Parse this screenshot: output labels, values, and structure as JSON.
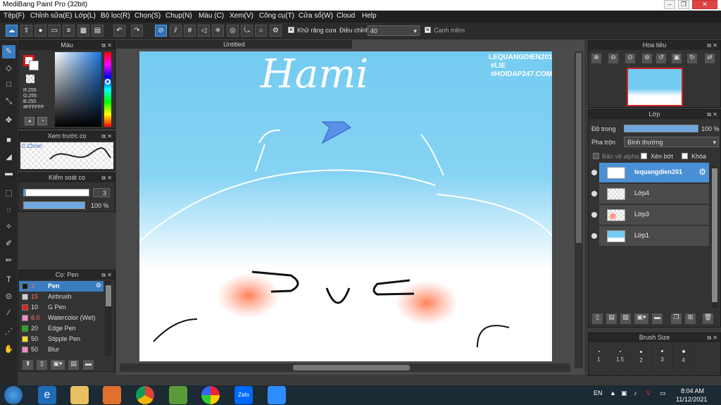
{
  "app": {
    "title": "MediBang Paint Pro (32bit)"
  },
  "menu": [
    "Tệp(F)",
    "Chỉnh sửa(E)",
    "Lớp(L)",
    "Bộ lọc(R)",
    "Chọn(S)",
    "Chụp(N)",
    "Màu (C)",
    "Xem(V)",
    "Công cụ(T)",
    "Cửa sổ(W)",
    "Cloud",
    "Help"
  ],
  "toolbar": {
    "antialias_label": "Khử răng cưa",
    "adjust_label": "Điều chỉnh",
    "adjust_value": "40",
    "sharp_edge_label": "Cạnh mềm",
    "antialias_mark": "✕",
    "sharp_mark": "✕"
  },
  "color_panel": {
    "title": "Màu",
    "r": "R:255",
    "g": "G:255",
    "b": "B:255",
    "hex": "#FFFFFF"
  },
  "brush_preview": {
    "title": "Xem trước cọ",
    "size": "0.22mm"
  },
  "brush_control": {
    "title": "Kiểm soát cọ",
    "size_value": "3",
    "opacity_value": "100 %"
  },
  "brush_list": {
    "title": "Cọ: Pen",
    "items": [
      {
        "size": "3",
        "name": "Pen",
        "color": "#1a1a1a"
      },
      {
        "size": "15",
        "name": "Airbrush",
        "color": "#cfcfcf"
      },
      {
        "size": "10",
        "name": "G Pen",
        "color": "#e02020"
      },
      {
        "size": "8.0",
        "name": "Watercolor (Wet)",
        "color": "#ff88cc"
      },
      {
        "size": "20",
        "name": "Edge Pen",
        "color": "#18b018"
      },
      {
        "size": "50",
        "name": "Stipple Pen",
        "color": "#f0e020"
      },
      {
        "size": "50",
        "name": "Blur",
        "color": "#ff88cc"
      }
    ]
  },
  "canvas": {
    "tab_title": "Untitled",
    "title_text": "Hami",
    "watermark": [
      "LEQUANGDIEN201",
      "#LIE",
      "#HOIDAP247.COM"
    ]
  },
  "navigator": {
    "title": "Hoa tiêu"
  },
  "layers": {
    "title": "Lớp",
    "opacity_label": "Độ trong",
    "opacity_value": "100 %",
    "blend_label": "Pha trộn",
    "blend_value": "Bình thường",
    "protect_alpha": "Bảo vệ alpha",
    "clipping": "Xén bớt",
    "lock": "Khóa",
    "items": [
      {
        "name": "lequangdien201"
      },
      {
        "name": "Lớp4"
      },
      {
        "name": "Lớp3"
      },
      {
        "name": "Lớp1"
      }
    ]
  },
  "brush_size": {
    "title": "Brush Size",
    "values": [
      "1",
      "1.5",
      "2",
      "3",
      "4"
    ]
  },
  "taskbar": {
    "lang": "EN",
    "time": "8:04 AM",
    "date": "11/12/2021",
    "zalo_label": "Zalo"
  }
}
